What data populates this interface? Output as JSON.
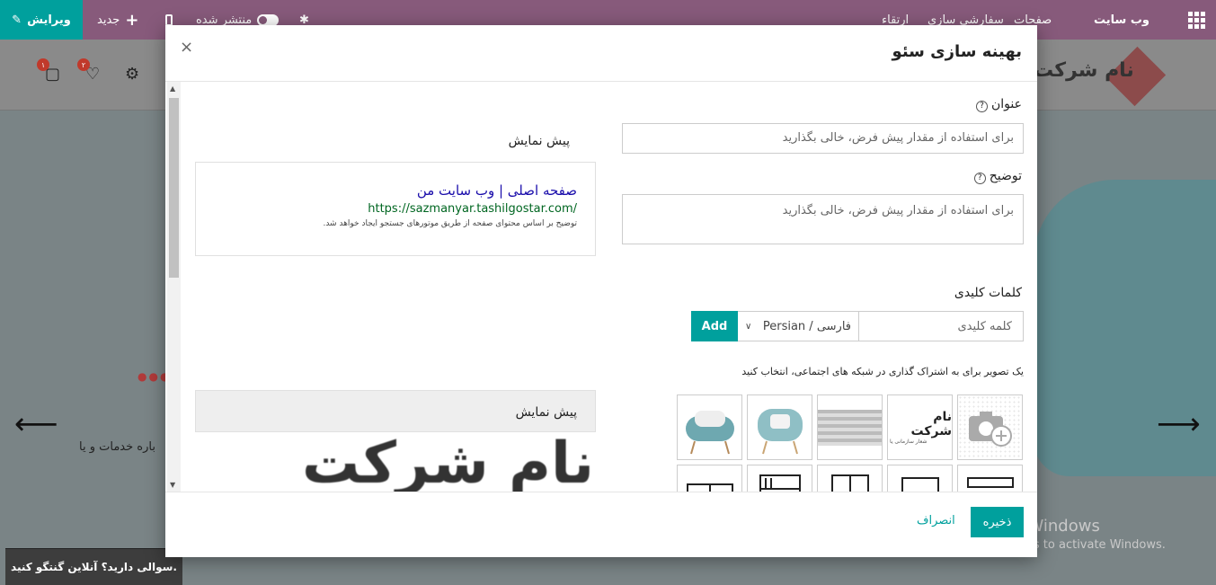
{
  "topbar": {
    "brand": "وب سایت",
    "menu": [
      "صفحات",
      "سفارشی سازی",
      "ارتقاء"
    ],
    "published_label": "منتشر شده",
    "new_label": "جدید",
    "edit_label": "ویرایش"
  },
  "background": {
    "logo_text": "نام شرکت",
    "logo_subtext": "شعار سازمانی یا عبارت",
    "wishlist_count": "۲",
    "cart_count": "۱",
    "body_text": "باره خدمات و یا",
    "chat_text": "سوالی دارید؟ آنلاین گنتگو کنید.",
    "watermark_title": "Activate Windows",
    "watermark_sub": "Go to Settings to activate Windows."
  },
  "modal": {
    "title": "بهینه سازی سئو",
    "close": "×",
    "title_label": "عنوان",
    "title_placeholder": "برای استفاده از مقدار پیش فرض، خالی بگذارید",
    "desc_label": "توضیح",
    "desc_placeholder": "برای استفاده از مقدار پیش فرض، خالی بگذارید",
    "keywords_label": "کلمات کلیدی",
    "keyword_placeholder": "کلمه کلیدی",
    "language_selected": "Persian / فارسی",
    "add_label": "Add",
    "image_hint": "یک تصویر برای به اشتراک گذاری در شبکه های اجتماعی، انتخاب کنید",
    "preview_label": "پیش نمایش",
    "preview": {
      "title": "صفحه اصلی | وب سایت من",
      "url": "https://sazmanyar.tashilgostar.com/",
      "description": "توضیح بر اساس محتوای صفحه از طریق موتورهای جستجو ایجاد خواهد شد."
    },
    "social_preview_label": "پیش نمایش",
    "social_preview_text": "نام شرکت",
    "thumb_logo_text": "نام شرکت",
    "thumb_logo_sub": "شعار سازمانی یا",
    "save_label": "ذخیره",
    "cancel_label": "انصراف"
  },
  "colors": {
    "topbar": "#875a7b",
    "accent": "#00a09d"
  }
}
